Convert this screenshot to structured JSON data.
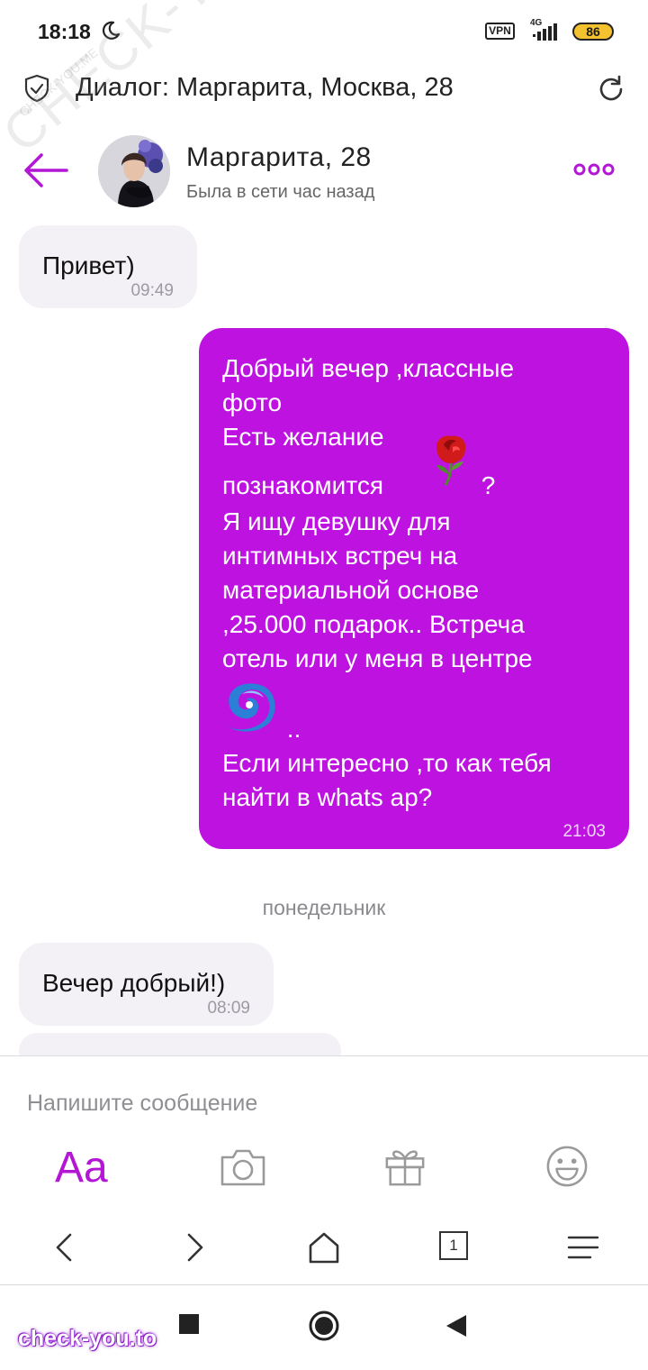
{
  "status_bar": {
    "time": "18:18",
    "vpn": "VPN",
    "network": "4G",
    "battery": "86"
  },
  "watermarks": {
    "main": "CHECK-YOU.ME",
    "small": "CHECK-YOU.ME",
    "footer": "check-you.to"
  },
  "browser": {
    "title": "Диалог: Маргарита, Москва, 28"
  },
  "chat": {
    "contact_name": "Маргарита, 28",
    "contact_status": "Была в сети час назад",
    "messages": [
      {
        "direction": "in",
        "text": "Привет)",
        "time": "09:49"
      },
      {
        "direction": "out",
        "part1": "Добрый вечер ,классные\nфото\nЕсть желание\n",
        "line_with_rose": "познакомится",
        "after_rose": " ?",
        "part2": "Я ищу девушку для\nинтимных встреч на\nматериальной основе\n,25.000 подарок.. Встреча\nотель или у меня в центре",
        "after_cyclone": " ..",
        "part3": "Если интересно ,то как тебя\nнайти в whats ap?",
        "time": "21:03"
      },
      {
        "direction": "in",
        "text": "Вечер добрый!)",
        "time": "08:09"
      }
    ],
    "day_separator": "понедельник"
  },
  "input": {
    "placeholder": "Напишите сообщение",
    "format_label": "Aa"
  },
  "icons": {
    "moon": "moon-icon",
    "shield": "shield-check-icon",
    "reload": "reload-icon",
    "back": "back-arrow-icon",
    "more": "more-dots-icon",
    "camera": "camera-icon",
    "gift": "gift-icon",
    "emoji": "smiley-icon"
  },
  "browser_nav": {
    "tab_count": "1"
  },
  "colors": {
    "accent": "#bd12e0",
    "incoming_bubble": "#f3f1f6",
    "battery": "#f4c22e"
  }
}
